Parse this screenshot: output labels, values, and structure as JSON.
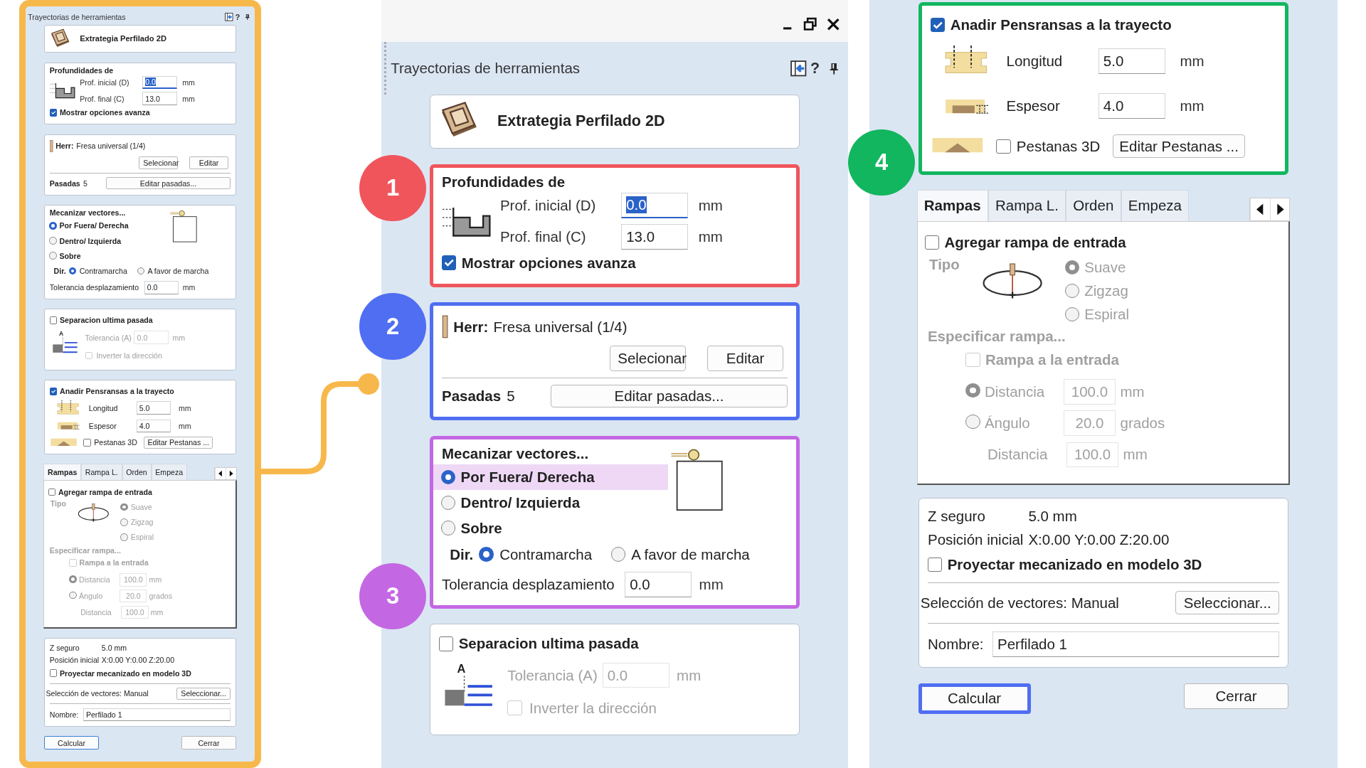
{
  "left_panel": {
    "title": "Trayectorias de herramientas",
    "help": "?",
    "sections": [
      {
        "kind": "strategy",
        "title": "Extrategia Perfilado 2D"
      },
      {
        "kind": "depths",
        "heading": "Profundidades de",
        "fields": [
          {
            "label": "Prof. inicial (D)",
            "value": "0.0",
            "unit": "mm",
            "focused": true
          },
          {
            "label": "Prof. final (C)",
            "value": "13.0",
            "unit": "mm",
            "focused": false
          }
        ],
        "checkbox": {
          "label": "Mostrar opciones avanza",
          "checked": true
        }
      },
      {
        "kind": "tool",
        "label": "Herr:",
        "name": "Fresa universal (1/4)",
        "buttons": [
          "Selecionar",
          "Editar"
        ],
        "passes_label": "Pasadas",
        "passes_value": "5",
        "passes_button": "Editar pasadas..."
      },
      {
        "kind": "vectors",
        "heading": "Mecanizar vectores...",
        "options": [
          {
            "label": "Por Fuera/ Derecha",
            "selected": true,
            "hovered": false
          },
          {
            "label": "Dentro/ Izquierda",
            "selected": false,
            "hovered": false
          },
          {
            "label": "Sobre",
            "selected": false,
            "hovered": false
          }
        ],
        "direction_label": "Dir.",
        "directions": [
          {
            "label": "Contramarcha",
            "selected": true
          },
          {
            "label": "A favor de marcha",
            "selected": false
          }
        ],
        "tolerance": {
          "label": "Tolerancia desplazamiento",
          "value": "0.0",
          "unit": "mm"
        }
      },
      {
        "kind": "last_pass",
        "disabled": true,
        "checkbox": {
          "label": "Separacion ultima pasada",
          "checked": false
        },
        "diagram_label": "A",
        "tolerance": {
          "label": "Tolerancia (A)",
          "value": "0.0",
          "unit": "mm"
        },
        "invert": {
          "label": "Inverter la dirección",
          "checked": false
        }
      },
      {
        "kind": "tabs_section",
        "checkbox": {
          "label": "Anadir Pensransas a la trayecto",
          "checked": true
        },
        "fields": [
          {
            "label": "Longitud",
            "value": "5.0",
            "unit": "mm"
          },
          {
            "label": "Espesor",
            "value": "4.0",
            "unit": "mm"
          }
        ],
        "tabs3d": {
          "label": "Pestanas 3D",
          "checked": false
        },
        "button": "Editar Pestanas ..."
      },
      {
        "kind": "ramps",
        "disabled": true,
        "tabs": [
          {
            "label": "Rampas",
            "selected": true
          },
          {
            "label": "Rampa L.",
            "selected": false
          },
          {
            "label": "Orden",
            "selected": false
          },
          {
            "label": "Empeza",
            "selected": false
          }
        ],
        "checkbox": {
          "label": "Agregar rampa de entrada",
          "checked": false
        },
        "type_label": "Tipo",
        "types": [
          {
            "label": "Suave",
            "selected": true
          },
          {
            "label": "Zigzag",
            "selected": false
          },
          {
            "label": "Espiral",
            "selected": false
          }
        ],
        "specify_label": "Especificar rampa...",
        "entry": {
          "label": "Rampa a la entrada",
          "checked": false
        },
        "rows": [
          {
            "kind": "radio",
            "label": "Distancia",
            "selected": true,
            "value": "100.0",
            "unit": "mm"
          },
          {
            "kind": "radio",
            "label": "Ángulo",
            "selected": false,
            "value": "20.0",
            "unit": "grados"
          },
          {
            "kind": "plain",
            "label": "Distancia",
            "value": "100.0",
            "unit": "mm"
          }
        ]
      },
      {
        "kind": "info",
        "rows": [
          {
            "label": "Z seguro",
            "value": "5.0 mm"
          },
          {
            "label": "Posición inicial",
            "value": "X:0.00 Y:0.00 Z:20.00"
          }
        ],
        "checkbox": {
          "label": "Proyectar mecanizado en modelo 3D",
          "checked": false
        },
        "selection": "Selección de vectores: Manual",
        "selection_button": "Seleccionar...",
        "name_label": "Nombre:",
        "name_value": "Perfilado 1"
      },
      {
        "kind": "actions",
        "buttons": [
          {
            "label": "Calcular",
            "focused": true,
            "highlighted": false
          },
          {
            "label": "Cerrar",
            "focused": false,
            "highlighted": false
          }
        ]
      }
    ]
  },
  "middle_panel": {
    "window_bar": true,
    "title": "Trayectorias de herramientas",
    "help": "?",
    "sections": [
      {
        "kind": "strategy",
        "title": "Extrategia Perfilado 2D"
      },
      {
        "kind": "depths",
        "callout": {
          "number": "1",
          "color": "#f0555b"
        },
        "heading": "Profundidades de",
        "fields": [
          {
            "label": "Prof. inicial (D)",
            "value": "0.0",
            "unit": "mm",
            "focused": true
          },
          {
            "label": "Prof. final (C)",
            "value": "13.0",
            "unit": "mm",
            "focused": false
          }
        ],
        "checkbox": {
          "label": "Mostrar opciones avanza",
          "checked": true
        }
      },
      {
        "kind": "tool",
        "callout": {
          "number": "2",
          "color": "#4f6ef2"
        },
        "label": "Herr:",
        "name": "Fresa universal (1/4)",
        "buttons": [
          "Selecionar",
          "Editar"
        ],
        "passes_label": "Pasadas",
        "passes_value": "5",
        "passes_button": "Editar pasadas..."
      },
      {
        "kind": "vectors",
        "callout": {
          "number": "3",
          "color": "#c467e3"
        },
        "heading": "Mecanizar vectores...",
        "options": [
          {
            "label": "Por Fuera/ Derecha",
            "selected": true,
            "hovered": true
          },
          {
            "label": "Dentro/ Izquierda",
            "selected": false,
            "hovered": false
          },
          {
            "label": "Sobre",
            "selected": false,
            "hovered": false
          }
        ],
        "direction_label": "Dir.",
        "directions": [
          {
            "label": "Contramarcha",
            "selected": true
          },
          {
            "label": "A favor de marcha",
            "selected": false
          }
        ],
        "tolerance": {
          "label": "Tolerancia desplazamiento",
          "value": "0.0",
          "unit": "mm"
        }
      },
      {
        "kind": "last_pass",
        "disabled": true,
        "checkbox": {
          "label": "Separacion ultima pasada",
          "checked": false
        },
        "diagram_label": "A",
        "tolerance": {
          "label": "Tolerancia (A)",
          "value": "0.0",
          "unit": "mm"
        },
        "invert": {
          "label": "Inverter la dirección",
          "checked": false
        }
      }
    ]
  },
  "right_panel": {
    "sections": [
      {
        "kind": "tabs_section",
        "callout": {
          "number": "4",
          "color": "#12b65f"
        },
        "checkbox": {
          "label": "Anadir Pensransas a la trayecto",
          "checked": true
        },
        "fields": [
          {
            "label": "Longitud",
            "value": "5.0",
            "unit": "mm"
          },
          {
            "label": "Espesor",
            "value": "4.0",
            "unit": "mm"
          }
        ],
        "tabs3d": {
          "label": "Pestanas 3D",
          "checked": false
        },
        "button": "Editar Pestanas ..."
      },
      {
        "kind": "ramps",
        "disabled": true,
        "tabs": [
          {
            "label": "Rampas",
            "selected": true
          },
          {
            "label": "Rampa L.",
            "selected": false
          },
          {
            "label": "Orden",
            "selected": false
          },
          {
            "label": "Empeza",
            "selected": false
          }
        ],
        "checkbox": {
          "label": "Agregar rampa de entrada",
          "checked": false
        },
        "type_label": "Tipo",
        "types": [
          {
            "label": "Suave",
            "selected": true
          },
          {
            "label": "Zigzag",
            "selected": false
          },
          {
            "label": "Espiral",
            "selected": false
          }
        ],
        "specify_label": "Especificar rampa...",
        "entry": {
          "label": "Rampa a la entrada",
          "checked": false
        },
        "rows": [
          {
            "kind": "radio",
            "label": "Distancia",
            "selected": true,
            "value": "100.0",
            "unit": "mm"
          },
          {
            "kind": "radio",
            "label": "Ángulo",
            "selected": false,
            "value": "20.0",
            "unit": "grados"
          },
          {
            "kind": "plain",
            "label": "Distancia",
            "value": "100.0",
            "unit": "mm"
          }
        ]
      },
      {
        "kind": "info",
        "rows": [
          {
            "label": "Z seguro",
            "value": "5.0 mm"
          },
          {
            "label": "Posición inicial",
            "value": "X:0.00 Y:0.00 Z:20.00"
          }
        ],
        "checkbox": {
          "label": "Proyectar mecanizado en modelo 3D",
          "checked": false
        },
        "selection": "Selección de vectores: Manual",
        "selection_button": "Seleccionar...",
        "name_label": "Nombre:",
        "name_value": "Perfilado 1"
      },
      {
        "kind": "actions",
        "buttons": [
          {
            "label": "Calcular",
            "focused": true,
            "highlighted": true
          },
          {
            "label": "Cerrar",
            "focused": false,
            "highlighted": false
          }
        ]
      }
    ]
  }
}
